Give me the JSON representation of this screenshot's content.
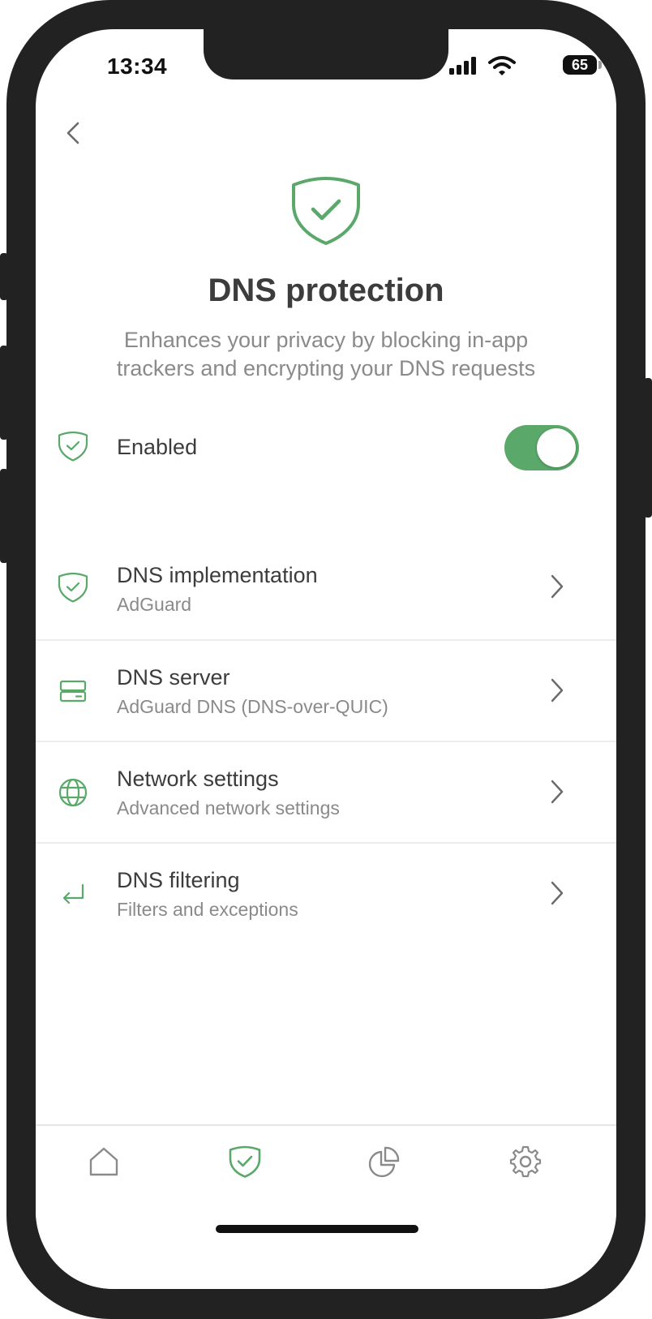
{
  "status_bar": {
    "time": "13:34",
    "battery_level": "65",
    "icons": [
      "signal-icon",
      "wifi-icon",
      "battery-icon"
    ]
  },
  "header": {
    "back_icon": "chevron-left-icon",
    "hero_icon": "shield-check-icon",
    "title": "DNS protection",
    "subtitle": "Enhances your privacy by blocking in-app trackers and encrypting your DNS requests"
  },
  "enabled_row": {
    "icon": "shield-check-icon",
    "label": "Enabled",
    "toggle_on": true
  },
  "menu": [
    {
      "icon": "shield-check-icon",
      "title": "DNS implementation",
      "subtitle": "AdGuard"
    },
    {
      "icon": "server-icon",
      "title": "DNS server",
      "subtitle": "AdGuard DNS (DNS-over-QUIC)"
    },
    {
      "icon": "globe-icon",
      "title": "Network settings",
      "subtitle": "Advanced network settings"
    },
    {
      "icon": "filter-arrow-icon",
      "title": "DNS filtering",
      "subtitle": "Filters and exceptions"
    }
  ],
  "tab_bar": {
    "tabs": [
      "home-icon",
      "shield-check-icon",
      "statistics-icon",
      "settings-gear-icon"
    ],
    "active_index": 1
  },
  "colors": {
    "accent": "#5aa86a",
    "text_primary": "#3c3c3c",
    "text_secondary": "#8a8a8a",
    "divider": "#ececec"
  }
}
